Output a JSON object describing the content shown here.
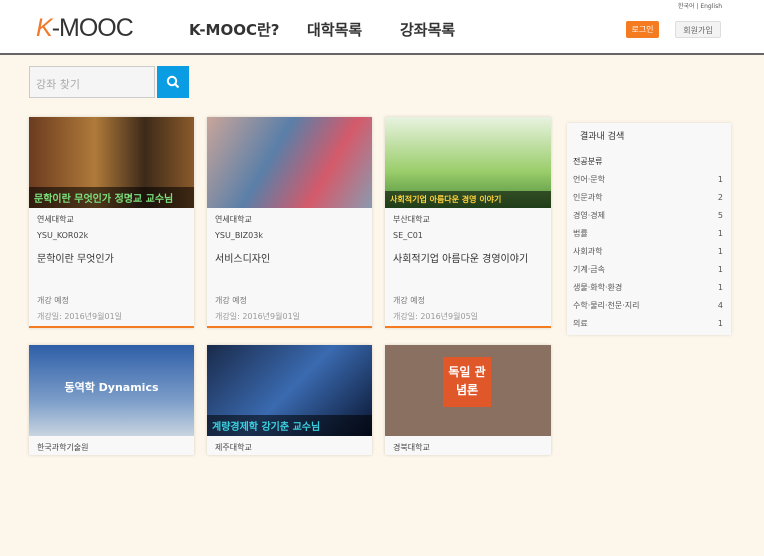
{
  "header": {
    "lang": "한국어 | English",
    "logo": {
      "k": "K",
      "rest": "-MOOC"
    },
    "nav": [
      "K-MOOC란?",
      "대학목록",
      "강좌목록"
    ],
    "login": "로그인",
    "join": "회원가입"
  },
  "search": {
    "placeholder": "강좌 찾기"
  },
  "courses": [
    {
      "university": "연세대학교",
      "code": "YSU_KOR02k",
      "title": "문학이란 무엇인가",
      "status": "개강 예정",
      "date": "개강일: 2016년9월01일",
      "overlay": "문학이란 무엇인가 정명교 교수님"
    },
    {
      "university": "연세대학교",
      "code": "YSU_BIZ03k",
      "title": "서비스디자인",
      "status": "개강 예정",
      "date": "개강일: 2016년9월01일",
      "overlay": ""
    },
    {
      "university": "부산대학교",
      "code": "SE_C01",
      "title": "사회적기업 아름다운 경영이야기",
      "status": "개강 예정",
      "date": "개강일: 2016년9월05일",
      "overlay": "사회적기업 아름다운 경영 이야기"
    },
    {
      "university": "한국과학기술원",
      "overlay": "동역학 Dynamics"
    },
    {
      "university": "제주대학교",
      "overlay": "계량경제학 강기춘 교수님"
    },
    {
      "university": "경북대학교",
      "overlay": "독일 관념론"
    }
  ],
  "sidebar": {
    "title": "결과내 검색",
    "section": "전공분류",
    "categories": [
      {
        "name": "언어·문학",
        "count": "1"
      },
      {
        "name": "인문과학",
        "count": "2"
      },
      {
        "name": "경영·경제",
        "count": "5"
      },
      {
        "name": "법률",
        "count": "1"
      },
      {
        "name": "사회과학",
        "count": "1"
      },
      {
        "name": "기계·금속",
        "count": "1"
      },
      {
        "name": "생물·화학·환경",
        "count": "1"
      },
      {
        "name": "수학·물리·천문·지리",
        "count": "4"
      },
      {
        "name": "의료",
        "count": "1"
      }
    ]
  }
}
